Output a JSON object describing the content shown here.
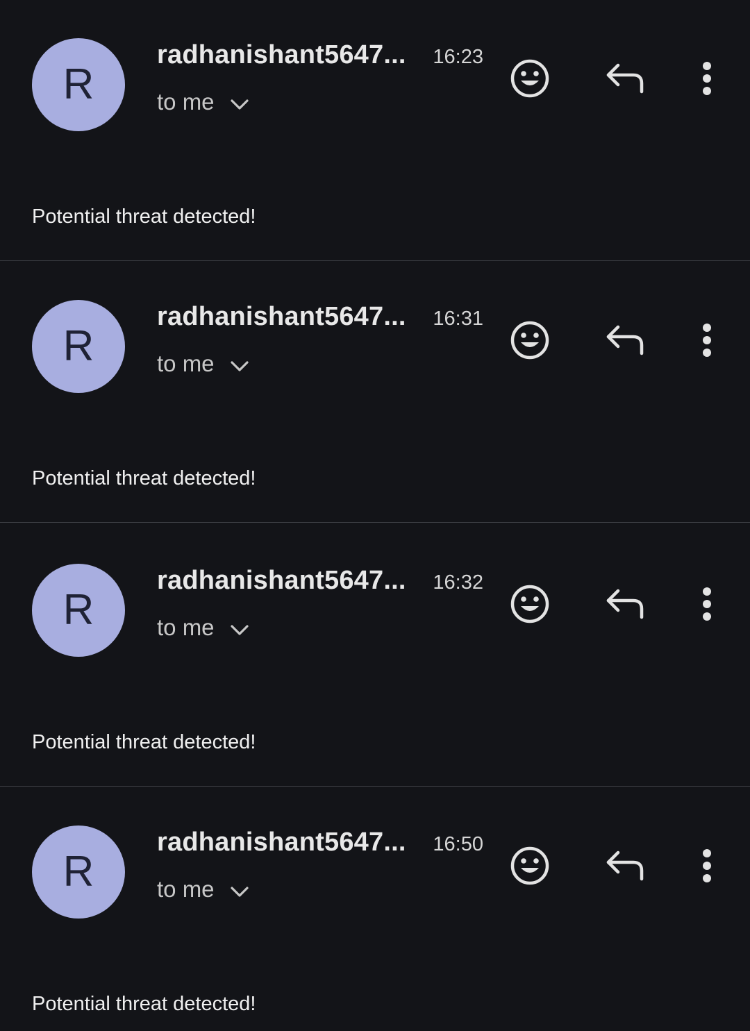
{
  "messages": [
    {
      "avatar_letter": "R",
      "sender": "radhanishant5647...",
      "time": "16:23",
      "recipient": "to me",
      "body": "Potential threat detected!"
    },
    {
      "avatar_letter": "R",
      "sender": "radhanishant5647...",
      "time": "16:31",
      "recipient": "to me",
      "body": "Potential threat detected!"
    },
    {
      "avatar_letter": "R",
      "sender": "radhanishant5647...",
      "time": "16:32",
      "recipient": "to me",
      "body": "Potential threat detected!"
    },
    {
      "avatar_letter": "R",
      "sender": "radhanishant5647...",
      "time": "16:50",
      "recipient": "to me",
      "body": "Potential threat detected!"
    }
  ],
  "colors": {
    "background": "#131418",
    "avatar": "#a8aee0",
    "divider": "#3b3d42",
    "icon": "#e3e3e3"
  },
  "icons": {
    "emoji": "add-reaction-icon",
    "reply": "reply-icon",
    "more": "more-vert-icon",
    "expand": "chevron-down-icon"
  }
}
